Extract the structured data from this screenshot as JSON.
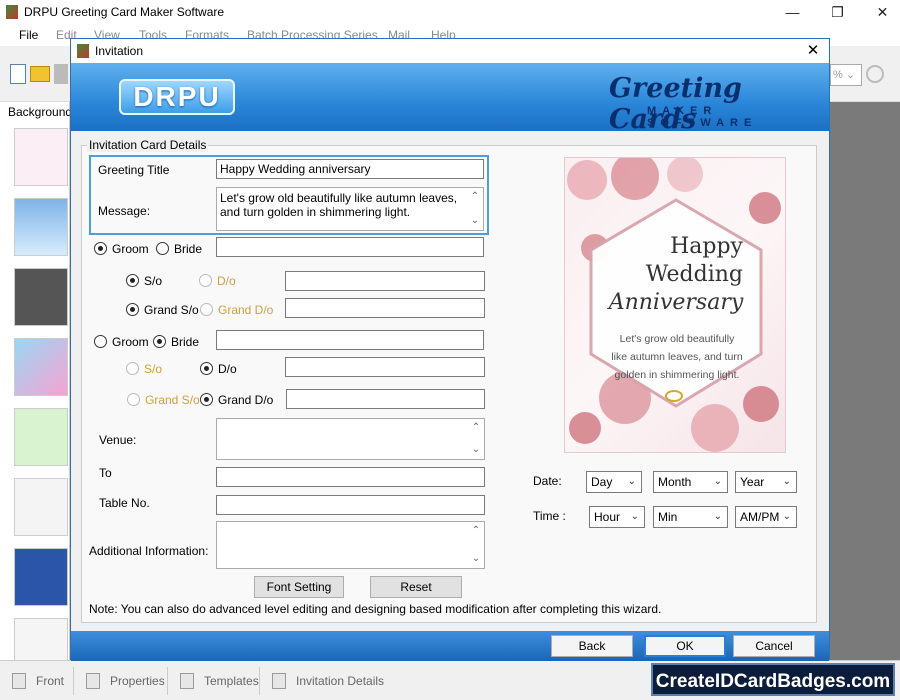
{
  "app": {
    "title": "DRPU Greeting Card Maker Software",
    "menu": [
      "File",
      "Edit",
      "View",
      "Tools",
      "Formats",
      "Batch Processing Series",
      "Mail",
      "Help"
    ],
    "left_panel_title": "Background"
  },
  "bottom_tabs": [
    "Front",
    "Properties",
    "Templates",
    "Invitation Details"
  ],
  "watermark": "CreateIDCardBadges.com",
  "dialog": {
    "title": "Invitation",
    "brand_logo": "DRPU",
    "banner_title": "Greeting Cards",
    "banner_subtitle": "MAKER SOFTWARE",
    "group_title": "Invitation Card Details",
    "greeting_title_label": "Greeting Title",
    "greeting_title_value": "Happy Wedding anniversary",
    "message_label": "Message:",
    "message_value": "Let's grow old beautifully like autumn leaves, and turn golden in shimmering light.",
    "first_party": {
      "groom": "Groom",
      "bride": "Bride",
      "selected": "Groom",
      "so": "S/o",
      "do": "D/o",
      "grand_so": "Grand S/o",
      "grand_do": "Grand D/o"
    },
    "second_party": {
      "groom": "Groom",
      "bride": "Bride",
      "selected": "Bride",
      "so": "S/o",
      "do": "D/o",
      "grand_so": "Grand S/o",
      "grand_do": "Grand D/o"
    },
    "venue_label": "Venue:",
    "to_label": "To",
    "table_label": "Table No.",
    "additional_label": "Additional Information:",
    "font_setting_button": "Font Setting",
    "reset_button": "Reset",
    "date_label": "Date:",
    "time_label": "Time :",
    "date_selects": [
      "Day",
      "Month",
      "Year"
    ],
    "time_selects": [
      "Hour",
      "Min",
      "AM/PM"
    ],
    "note": "Note: You can also do advanced level editing and designing based modification after completing this wizard.",
    "back_button": "Back",
    "ok_button": "OK",
    "cancel_button": "Cancel"
  },
  "card_preview": {
    "line1": "Happy",
    "line2": "Wedding",
    "line3": "Anniversary",
    "message": "Let's grow old beautifully like autumn leaves, and turn golden in shimmering light."
  },
  "colors": {
    "accent": "#2a86d8",
    "highlight_border": "#4aa0de",
    "card_floral": "#c9646e"
  }
}
